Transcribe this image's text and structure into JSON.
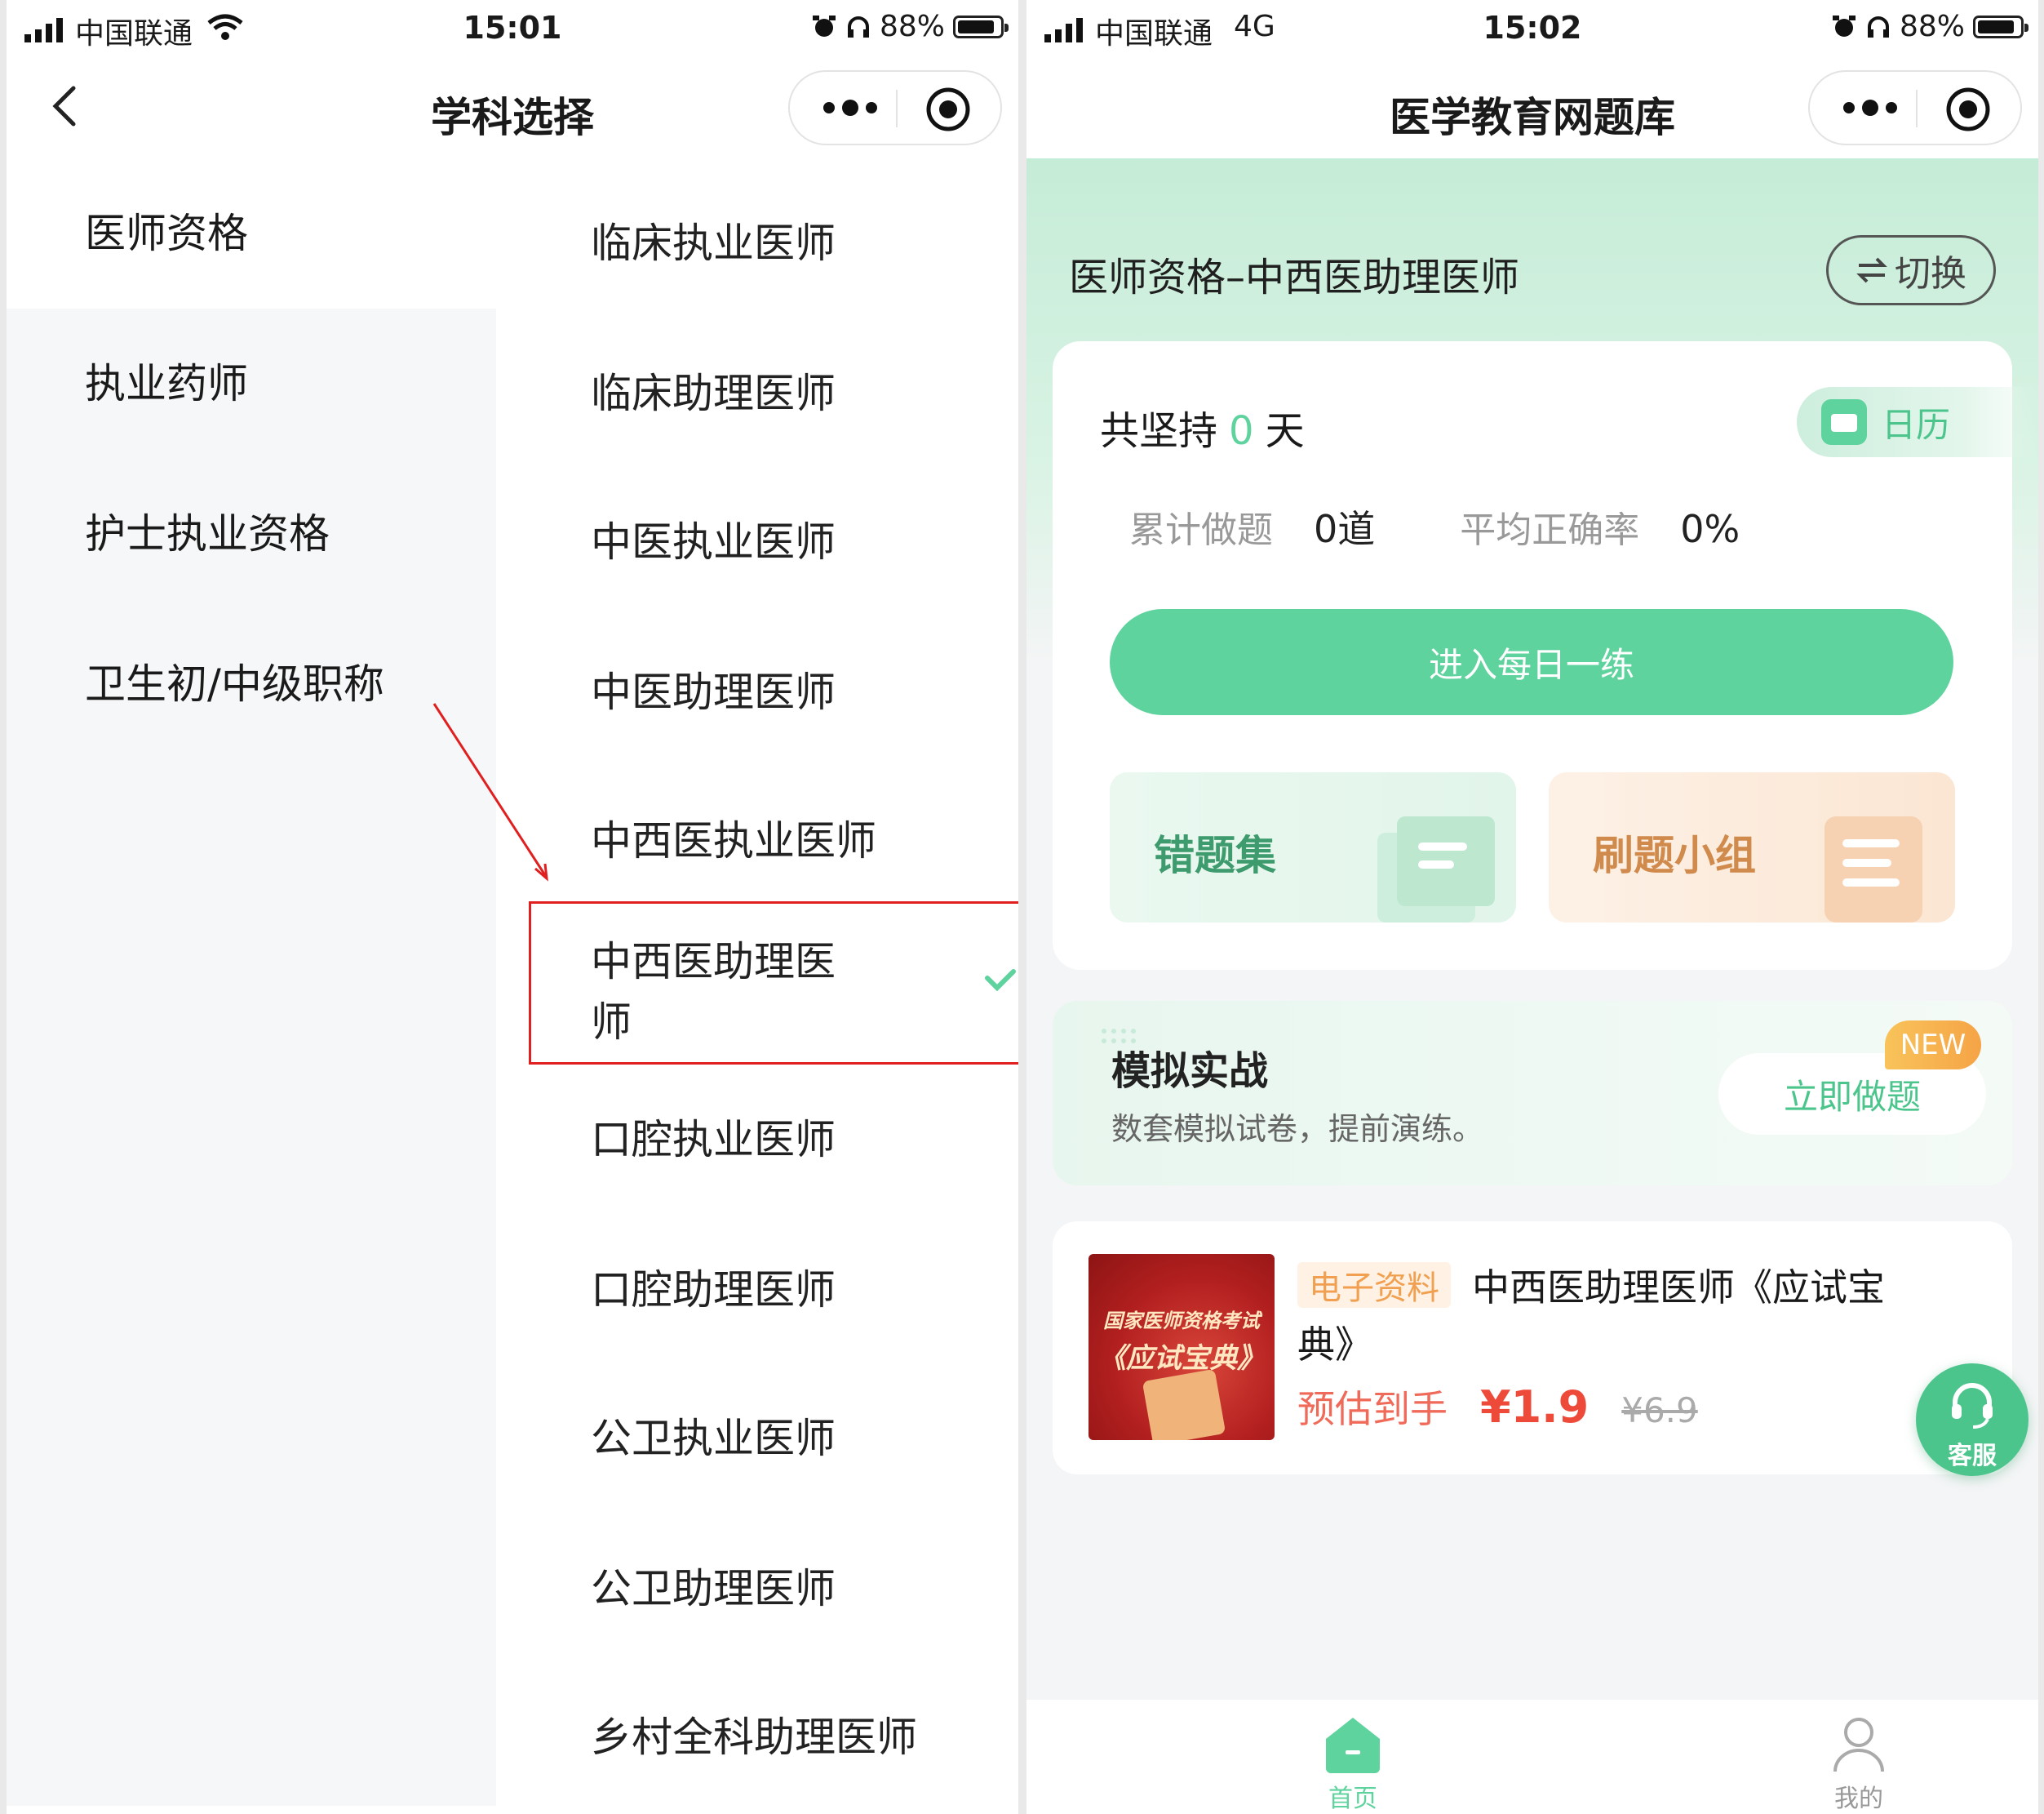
{
  "left": {
    "status": {
      "carrier": "中国联通",
      "time": "15:01",
      "battery": "88%"
    },
    "nav": {
      "title": "学科选择"
    },
    "categories": [
      "医师资格",
      "执业药师",
      "护士执业资格",
      "卫生初/中级职称"
    ],
    "subjects": [
      "临床执业医师",
      "临床助理医师",
      "中医执业医师",
      "中医助理医师",
      "中西医执业医师",
      "中西医助理医",
      "师",
      "口腔执业医师",
      "口腔助理医师",
      "公卫执业医师",
      "公卫助理医师",
      "乡村全科助理医师"
    ]
  },
  "right": {
    "status": {
      "carrier": "中国联通",
      "network": "4G",
      "time": "15:02",
      "battery": "88%"
    },
    "nav": {
      "title": "医学教育网题库"
    },
    "subject": "医师资格–中西医助理医师",
    "switch_label": "切换",
    "streak": {
      "prefix": "共坚持",
      "days": "0",
      "suffix": "天"
    },
    "calendar_label": "日历",
    "stats": {
      "total_label": "累计做题",
      "total_value": "0道",
      "accuracy_label": "平均正确率",
      "accuracy_value": "0%"
    },
    "practice_button": "进入每日一练",
    "wrong_set": "错题集",
    "study_group": "刷题小组",
    "mock": {
      "title": "模拟实战",
      "desc": "数套模拟试卷，提前演练。",
      "button": "立即做题",
      "badge": "NEW"
    },
    "product": {
      "image_line1": "国家医师资格考试",
      "image_line2": "《应试宝典》",
      "tag": "电子资料",
      "title": "中西医助理医师《应试宝典》",
      "price_label": "预估到手",
      "price": "¥1.9",
      "original_price": "¥6.9"
    },
    "service_label": "客服",
    "tabs": [
      "首页",
      "我的"
    ]
  },
  "colors": {
    "accent_green": "#5fd39e",
    "highlight_red": "#e02020",
    "price_red": "#ee4a3a"
  }
}
